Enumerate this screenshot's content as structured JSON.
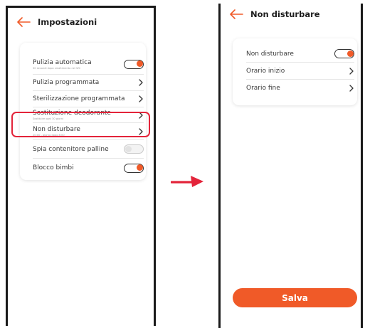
{
  "colors": {
    "accent": "#f05a28",
    "highlight": "#e3243a",
    "text": "#3a3a3a"
  },
  "left_screen": {
    "title": "Impostazioni",
    "back_icon": "arrow-left-icon",
    "settings": [
      {
        "label": "Pulizia automatica",
        "sublabel": "30 secondi dopo smaltimento nel WC",
        "control": "toggle",
        "on": true
      },
      {
        "label": "Pulizia programmata",
        "control": "chevron"
      },
      {
        "label": "Sterilizzazione programmata",
        "control": "chevron"
      },
      {
        "label": "Sostituzione deodorante",
        "sublabel": "Sostituire ogni 30 giorni",
        "control": "chevron"
      },
      {
        "label": "Non disturbare",
        "sublabel": "20:00 - giorno dopo 8:00",
        "control": "chevron",
        "highlighted": true
      },
      {
        "label": "Spia contenitore palline",
        "control": "toggle",
        "on": false
      },
      {
        "label": "Blocco bimbi",
        "control": "toggle",
        "on": true
      }
    ]
  },
  "right_screen": {
    "title": "Non disturbare",
    "back_icon": "arrow-left-icon",
    "settings": [
      {
        "label": "Non disturbare",
        "control": "toggle",
        "on": true
      },
      {
        "label": "Orario inizio",
        "control": "chevron"
      },
      {
        "label": "Orario fine",
        "control": "chevron"
      }
    ],
    "save_label": "Salva"
  },
  "flow_icon": "arrow-right-icon"
}
